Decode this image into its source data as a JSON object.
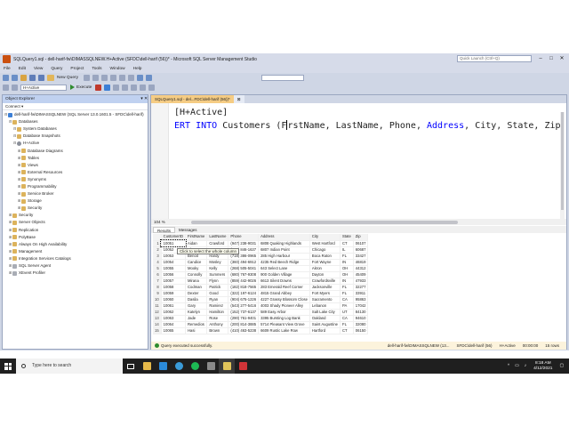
{
  "window": {
    "title": "SQLQuery1.sql - dell-harif-fw\\DIMASSQLNEW.H+Active (SFDC\\dell-harif (56))* - Microsoft SQL Server Management Studio",
    "quick_launch_placeholder": "Quick Launch (Ctrl+Q)"
  },
  "menu": [
    "File",
    "Edit",
    "View",
    "Query",
    "Project",
    "Tools",
    "Window",
    "Help"
  ],
  "toolbar": {
    "new_query": "New Query",
    "database": "H+Active",
    "execute": "Execute"
  },
  "object_explorer": {
    "title": "Object Explorer",
    "connect": "Connect ▾",
    "items": [
      {
        "label": "dell-harif-fw\\DIMASSQLNEW (SQL Server 13.0.1601.5 - SFDC\\dell-harif)",
        "level": 0,
        "icon": "server"
      },
      {
        "label": "Databases",
        "level": 1,
        "icon": "folder"
      },
      {
        "label": "System Databases",
        "level": 2,
        "icon": "folder"
      },
      {
        "label": "Database Snapshots",
        "level": 2,
        "icon": "folder"
      },
      {
        "label": "H+Active",
        "level": 2,
        "icon": "db"
      },
      {
        "label": "Database Diagrams",
        "level": 3,
        "icon": "folder"
      },
      {
        "label": "Tables",
        "level": 3,
        "icon": "folder"
      },
      {
        "label": "Views",
        "level": 3,
        "icon": "folder"
      },
      {
        "label": "External Resources",
        "level": 3,
        "icon": "folder"
      },
      {
        "label": "Synonyms",
        "level": 3,
        "icon": "folder"
      },
      {
        "label": "Programmability",
        "level": 3,
        "icon": "folder"
      },
      {
        "label": "Service Broker",
        "level": 3,
        "icon": "folder"
      },
      {
        "label": "Storage",
        "level": 3,
        "icon": "folder"
      },
      {
        "label": "Security",
        "level": 3,
        "icon": "folder"
      },
      {
        "label": "Security",
        "level": 1,
        "icon": "folder"
      },
      {
        "label": "Server Objects",
        "level": 1,
        "icon": "folder"
      },
      {
        "label": "Replication",
        "level": 1,
        "icon": "folder"
      },
      {
        "label": "PolyBase",
        "level": 1,
        "icon": "folder"
      },
      {
        "label": "Always On High Availability",
        "level": 1,
        "icon": "folder"
      },
      {
        "label": "Management",
        "level": 1,
        "icon": "folder"
      },
      {
        "label": "Integration Services Catalogs",
        "level": 1,
        "icon": "folder"
      },
      {
        "label": "SQL Server Agent",
        "level": 1,
        "icon": "grey"
      },
      {
        "label": "XEvent Profiler",
        "level": 1,
        "icon": "grey"
      }
    ]
  },
  "tabs": {
    "active": "SQLQuery1.sql - del...FDC\\dell-harif (56))*",
    "inactive": "⊠"
  },
  "editor": {
    "line1": "[H+Active]",
    "line2_kw": "ERT INTO",
    "line2_table": " Customers (",
    "line2_f": "F",
    "line2_rest": "rstName, LastName, Phone, ",
    "line2_addr": "Address",
    "line2_end": ", City, State, Zip)"
  },
  "zoom": "104 %",
  "results": {
    "tab_results": "Results",
    "tab_messages": "Messages",
    "tooltip": "Click to select the whole column",
    "columns": [
      "",
      "CustomerID",
      "FirstName",
      "LastName",
      "Phone",
      "Address",
      "City",
      "State",
      "Zip"
    ],
    "rows": [
      [
        "1",
        "10051",
        "Aidan",
        "Crawford",
        "(947) 238-9031",
        "6808 Quaking Highlands",
        "West Hartford",
        "CT",
        "06107"
      ],
      [
        "2",
        "10052",
        "Alonzo",
        "Mercer",
        "(972) 846-1637",
        "6807 Indian Point",
        "Chicago",
        "IL",
        "60687"
      ],
      [
        "3",
        "10053",
        "Benoit",
        "Hardy",
        "(718) 386-0965",
        "285 High Harbour",
        "Boca Raton",
        "FL",
        "33427"
      ],
      [
        "4",
        "10054",
        "Candice",
        "Mosley",
        "(360) 494-6912",
        "4235 Red Beech Ridge",
        "Fort Wayne",
        "IN",
        "46819"
      ],
      [
        "5",
        "10055",
        "Mooky",
        "Kelly",
        "(268) 505-5041",
        "643 Select Lane",
        "Akron",
        "OH",
        "44312"
      ],
      [
        "6",
        "10056",
        "Connolly",
        "Summers",
        "(680) 767-9308",
        "900 Golden Village",
        "Dayton",
        "OH",
        "45409"
      ],
      [
        "7",
        "10057",
        "Mirana",
        "Flynn",
        "(859) 442-9026",
        "6613 Silent Downs",
        "Crawfordsville",
        "IN",
        "47933"
      ],
      [
        "8",
        "10058",
        "Codman",
        "Patrick",
        "(182) 818-7565",
        "283 Emerald Reef Corner",
        "Jacksonville",
        "FL",
        "32277"
      ],
      [
        "9",
        "10059",
        "Dexter",
        "Good",
        "(322) 197-6124",
        "4815 Grand Abbey",
        "Fort Myers",
        "FL",
        "33911"
      ],
      [
        "10",
        "10060",
        "Dasila",
        "Ryan",
        "(904) 675-1226",
        "4227 Grassy Blossom Close",
        "Sacramento",
        "CA",
        "95863"
      ],
      [
        "11",
        "10061",
        "Gary",
        "Ramirez",
        "(543) 277-5416",
        "4003 Shady Pioneer Alley",
        "Lebanon",
        "PA",
        "17042"
      ],
      [
        "12",
        "10062",
        "Katelyn",
        "Hamilton",
        "(152) 737-6137",
        "589 Easy Arbor",
        "Salt Lake City",
        "UT",
        "84130"
      ],
      [
        "13",
        "10063",
        "Jade",
        "Rose",
        "(290) 761-9401",
        "3395 Bursting Log Bank",
        "Oakland",
        "CA",
        "94610"
      ],
      [
        "14",
        "10064",
        "Remedios",
        "Anthony",
        "(200) 814-3885",
        "5714 Pleasant View Grove",
        "Saint Augustine",
        "FL",
        "32080"
      ],
      [
        "15",
        "10065",
        "Hasi",
        "Brown",
        "(410) 463-5238",
        "6609 Rustic Lake Row",
        "Hartford",
        "CT",
        "06150"
      ]
    ]
  },
  "query_status": {
    "message": "Query executed successfully.",
    "server": "dell-harif-fw\\DIMASSQLNEW (13...",
    "user": "SFDC\\dell-harif (56)",
    "db": "H+Active",
    "time": "00:00:00",
    "rows": "15 rows"
  },
  "statusbar": {
    "ready": "Ready",
    "ln": "Ln 2",
    "col": "Col 25",
    "ch": "Ch 25",
    "ins": "INS"
  },
  "taskbar": {
    "search_placeholder": "Type here to search",
    "time": "8:18 AM",
    "date": "4/12/2021"
  },
  "colors": {
    "accent": "#007acc",
    "tab_active": "#f5cc84",
    "keyword": "#0000ff",
    "chrome": "#cfd6e5"
  }
}
